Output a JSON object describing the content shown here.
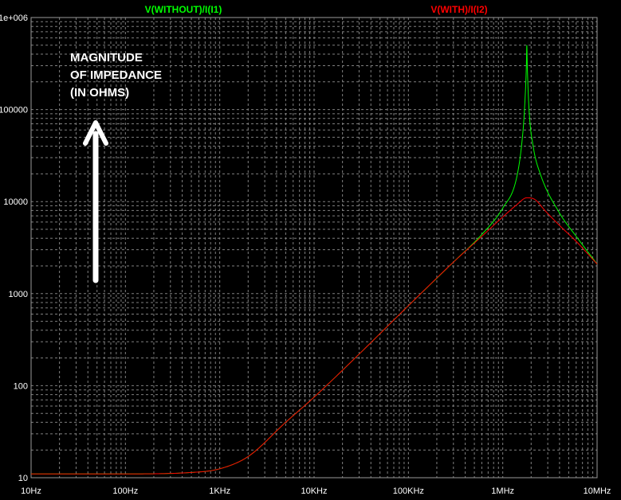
{
  "chart_data": {
    "type": "line",
    "title": "",
    "xlabel": "",
    "ylabel": "",
    "x_scale": "log",
    "y_scale": "log",
    "xlim": [
      10,
      10000000
    ],
    "ylim": [
      10,
      1000000
    ],
    "x_ticks": [
      {
        "value": 10,
        "label": "10Hz"
      },
      {
        "value": 100,
        "label": "100Hz"
      },
      {
        "value": 1000,
        "label": "1KHz"
      },
      {
        "value": 10000,
        "label": "10KHz"
      },
      {
        "value": 100000,
        "label": "100KHz"
      },
      {
        "value": 1000000,
        "label": "1MHz"
      },
      {
        "value": 10000000,
        "label": "10MHz"
      }
    ],
    "y_ticks": [
      {
        "value": 10,
        "label": "10"
      },
      {
        "value": 100,
        "label": "100"
      },
      {
        "value": 1000,
        "label": "1000"
      },
      {
        "value": 10000,
        "label": "10000"
      },
      {
        "value": 100000,
        "label": "100000"
      },
      {
        "value": 1000000,
        "label": "1e+006"
      }
    ],
    "grid": true,
    "background": "#000000",
    "grid_color": "#7f7f7f",
    "series": [
      {
        "name": "V(WITHOUT)/I(I1)",
        "color": "#00ff00",
        "x": [
          10,
          100,
          500,
          1000,
          2000,
          5000,
          10000,
          30000,
          100000,
          300000,
          600000,
          1000000,
          1400000,
          1600000,
          1700000,
          1780000,
          1800000,
          1820000,
          1900000,
          2100000,
          2500000,
          4000000,
          6000000,
          10000000
        ],
        "y": [
          11,
          11,
          11.4,
          12.5,
          17,
          40,
          75,
          220,
          740,
          2200,
          4400,
          8500,
          18000,
          45000,
          100000,
          300000,
          500000,
          300000,
          100000,
          40000,
          20000,
          7500,
          4200,
          2100
        ]
      },
      {
        "name": "V(WITH)/I(I2)",
        "color": "#ff0000",
        "x": [
          10,
          100,
          500,
          1000,
          2000,
          5000,
          10000,
          30000,
          100000,
          300000,
          600000,
          1000000,
          1400000,
          1800000,
          2200000,
          2800000,
          4000000,
          6000000,
          10000000
        ],
        "y": [
          11,
          11,
          11.4,
          12.5,
          17,
          40,
          75,
          220,
          740,
          2200,
          4200,
          6800,
          9200,
          11000,
          10500,
          8000,
          5500,
          3700,
          2100
        ]
      }
    ],
    "legend": "top",
    "annotation": {
      "lines": [
        "MAGNITUDE",
        "OF IMPEDANCE",
        "(IN OHMS)"
      ],
      "arrow": "up",
      "color": "#ffffff"
    }
  }
}
